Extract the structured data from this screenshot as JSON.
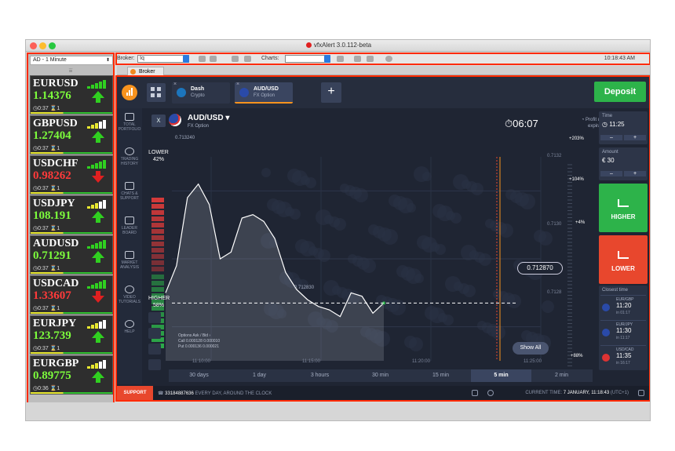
{
  "window": {
    "title": "vfxAlert 3.0.112-beta"
  },
  "left_panel": {
    "timeframe_select": "AD - 1 Minute",
    "filter_icon": "filter-icon",
    "tickers": [
      {
        "symbol": "EURUSD",
        "price": "1.14376",
        "direction": "up",
        "time": "0:37",
        "count": "1",
        "signal_bars": 5
      },
      {
        "symbol": "GBPUSD",
        "price": "1.27404",
        "direction": "up",
        "time": "0:37",
        "count": "1",
        "signal_bars": 3
      },
      {
        "symbol": "USDCHF",
        "price": "0.98262",
        "direction": "down",
        "time": "0:37",
        "count": "1",
        "signal_bars": 5
      },
      {
        "symbol": "USDJPY",
        "price": "108.191",
        "direction": "up",
        "time": "0:37",
        "count": "1",
        "signal_bars": 3
      },
      {
        "symbol": "AUDUSD",
        "price": "0.71291",
        "direction": "up",
        "time": "0:37",
        "count": "1",
        "signal_bars": 5
      },
      {
        "symbol": "USDCAD",
        "price": "1.33607",
        "direction": "down",
        "time": "0:37",
        "count": "1",
        "signal_bars": 5
      },
      {
        "symbol": "EURJPY",
        "price": "123.739",
        "direction": "up",
        "time": "0:37",
        "count": "1",
        "signal_bars": 3
      },
      {
        "symbol": "EURGBP",
        "price": "0.89775",
        "direction": "up",
        "time": "0:36",
        "count": "1",
        "signal_bars": 3
      }
    ]
  },
  "toolbar": {
    "broker_label": "Broker:",
    "broker_value": "Iq",
    "charts_label": "Charts:",
    "charts_value": "",
    "clock": "10:18:43 AM"
  },
  "tabs": {
    "broker_tab": "Broker"
  },
  "broker": {
    "assets": [
      {
        "name": "Dash",
        "sub": "Crypto",
        "color": "#1c75bc"
      },
      {
        "name": "AUD/USD",
        "sub": "FX Option",
        "color": "#2a4aa8"
      }
    ],
    "deposit_label": "Deposit",
    "nav": [
      {
        "label1": "TOTAL",
        "label2": "PORTFOLIO"
      },
      {
        "label1": "TRADING",
        "label2": "HISTORY"
      },
      {
        "label1": "CHATS &",
        "label2": "SUPPORT"
      },
      {
        "label1": "LEADER",
        "label2": "BOARD"
      },
      {
        "label1": "MARKET",
        "label2": "ANALYSIS"
      },
      {
        "label1": "VIDEO",
        "label2": "TUTORIALS"
      },
      {
        "label1": "HELP",
        "label2": ""
      }
    ],
    "chart_header": {
      "close_icon": "x",
      "pair": "AUD/USD ▾",
      "pair_sub": "FX Option",
      "timer": "⏱06:07",
      "profit_line1": "◔ Profit upon",
      "profit_line2": "expiration",
      "level_label": "0.713240"
    },
    "lower_label": "LOWER",
    "lower_pct": "42%",
    "higher_label": "HIGHER",
    "higher_pct": "58%",
    "current_price": "0.712870",
    "crosshair_label": "0.712830",
    "levels": [
      "0.7132",
      "0.7130",
      "0.7128"
    ],
    "percents": [
      "+203%",
      "+104%",
      "+4%",
      "+88%"
    ],
    "x_labels": [
      "11:10:00",
      "11:15:00",
      "11:20:00",
      "11:25:00"
    ],
    "show_all": "Show All",
    "ask_bid": {
      "title": "Options Ask / Bid ›",
      "call": "Call  0.000128  0.000010",
      "put": "Put   0.000136  0.000021"
    },
    "periods": [
      "30 days",
      "1 day",
      "3 hours",
      "30 min",
      "15 min",
      "5 min",
      "2 min"
    ],
    "active_period": "5 min",
    "time_box": {
      "label": "Time",
      "value": "◷ 11:25",
      "minus": "–",
      "plus": "+"
    },
    "amount_box": {
      "label": "Amount",
      "value": "€ 30",
      "minus": "–",
      "plus": "+"
    },
    "higher_button": "HIGHER",
    "lower_button": "LOWER",
    "closest": {
      "title": "Closest time",
      "items": [
        {
          "pair": "EUR/GBP",
          "time": "11:20",
          "in": "in 01:17",
          "color": "#2a4aa8"
        },
        {
          "pair": "EUR/JPY",
          "time": "11:30",
          "in": "in 11:17",
          "color": "#2a4aa8"
        },
        {
          "pair": "USD/CAD",
          "time": "11:35",
          "in": "in 16:17",
          "color": "#d33"
        }
      ]
    },
    "footer": {
      "support": "SUPPORT",
      "phone": "33184887636",
      "phone_tail": "EVERY DAY, AROUND THE CLOCK",
      "current_time_label": "CURRENT TIME:",
      "current_time_value": "7 JANUARY, 11:18:43",
      "tz": "(UTC+1)"
    },
    "colors": {
      "higher": "#2db34a",
      "lower": "#e8472d",
      "accent": "#f7931e",
      "bg": "#1f2533"
    }
  },
  "chart_data": {
    "type": "line",
    "y_ticks": [
      "0.7132",
      "0.7130",
      "0.7128"
    ],
    "x_ticks": [
      "11:10:00",
      "11:15:00",
      "11:20:00",
      "11:25:00"
    ],
    "current_price": 0.71287,
    "series": [
      {
        "values": [
          0.7129,
          0.71298,
          0.71318,
          0.71322,
          0.71316,
          0.713,
          0.71302,
          0.71312,
          0.71313,
          0.71311,
          0.71306,
          0.71296,
          0.71291,
          0.71288,
          0.71286,
          0.71285,
          0.71283,
          0.7129,
          0.71289,
          0.71284,
          0.71287
        ]
      }
    ]
  }
}
